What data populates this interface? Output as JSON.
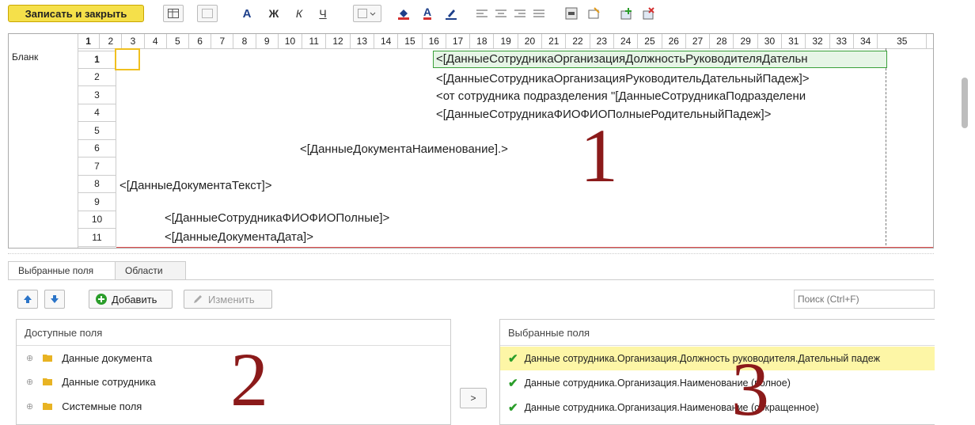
{
  "toolbar": {
    "save_close_label": "Записать и закрыть",
    "bold_label": "Ж",
    "italic_label": "К",
    "underline_label": "Ч",
    "font_label": "A",
    "font_color_label": "A"
  },
  "sheet": {
    "area_label": "Бланк",
    "columns": [
      "1",
      "2",
      "3",
      "4",
      "5",
      "6",
      "7",
      "8",
      "9",
      "10",
      "11",
      "12",
      "13",
      "14",
      "15",
      "16",
      "17",
      "18",
      "19",
      "20",
      "21",
      "22",
      "23",
      "24",
      "25",
      "26",
      "27",
      "28",
      "29",
      "30",
      "31",
      "32",
      "33",
      "34",
      "35"
    ],
    "rows": [
      "1",
      "2",
      "3",
      "4",
      "5",
      "6",
      "7",
      "8",
      "9",
      "10",
      "11"
    ],
    "cells": {
      "r1": "<[ДанныеСотрудникаОрганизацияДолжностьРуководителяДательн",
      "r2": "<[ДанныеСотрудникаОрганизацияРуководительДательныйПадеж]>",
      "r3": "<от сотрудника подразделения \"[ДанныеСотрудникаПодразделени",
      "r4": "<[ДанныеСотрудникаФИОФИОПолныеРодительныйПадеж]>",
      "r6": "<[ДанныеДокументаНаименование].>",
      "r8": "<[ДанныеДокументаТекст]>",
      "r10": "<[ДанныеСотрудникаФИОФИОПолные]>",
      "r11": "<[ДанныеДокументаДата]>"
    }
  },
  "annotations": {
    "n1": "1",
    "n2": "2",
    "n3": "3"
  },
  "tabs": {
    "selected_fields": "Выбранные поля",
    "areas": "Области"
  },
  "actions": {
    "add_label": "Добавить",
    "edit_label": "Изменить",
    "move_label": ">"
  },
  "search": {
    "placeholder": "Поиск (Ctrl+F)"
  },
  "available": {
    "header": "Доступные поля",
    "items": [
      "Данные документа",
      "Данные сотрудника",
      "Системные поля"
    ]
  },
  "selected": {
    "header": "Выбранные поля",
    "items": [
      "Данные сотрудника.Организация.Должность руководителя.Дательный падеж",
      "Данные сотрудника.Организация.Наименование (полное)",
      "Данные сотрудника.Организация.Наименование (сокращенное)"
    ]
  },
  "colors": {
    "accent_yellow": "#f5e04a",
    "check_green": "#2a9d2a",
    "annotation_red": "#8b1a1a"
  }
}
